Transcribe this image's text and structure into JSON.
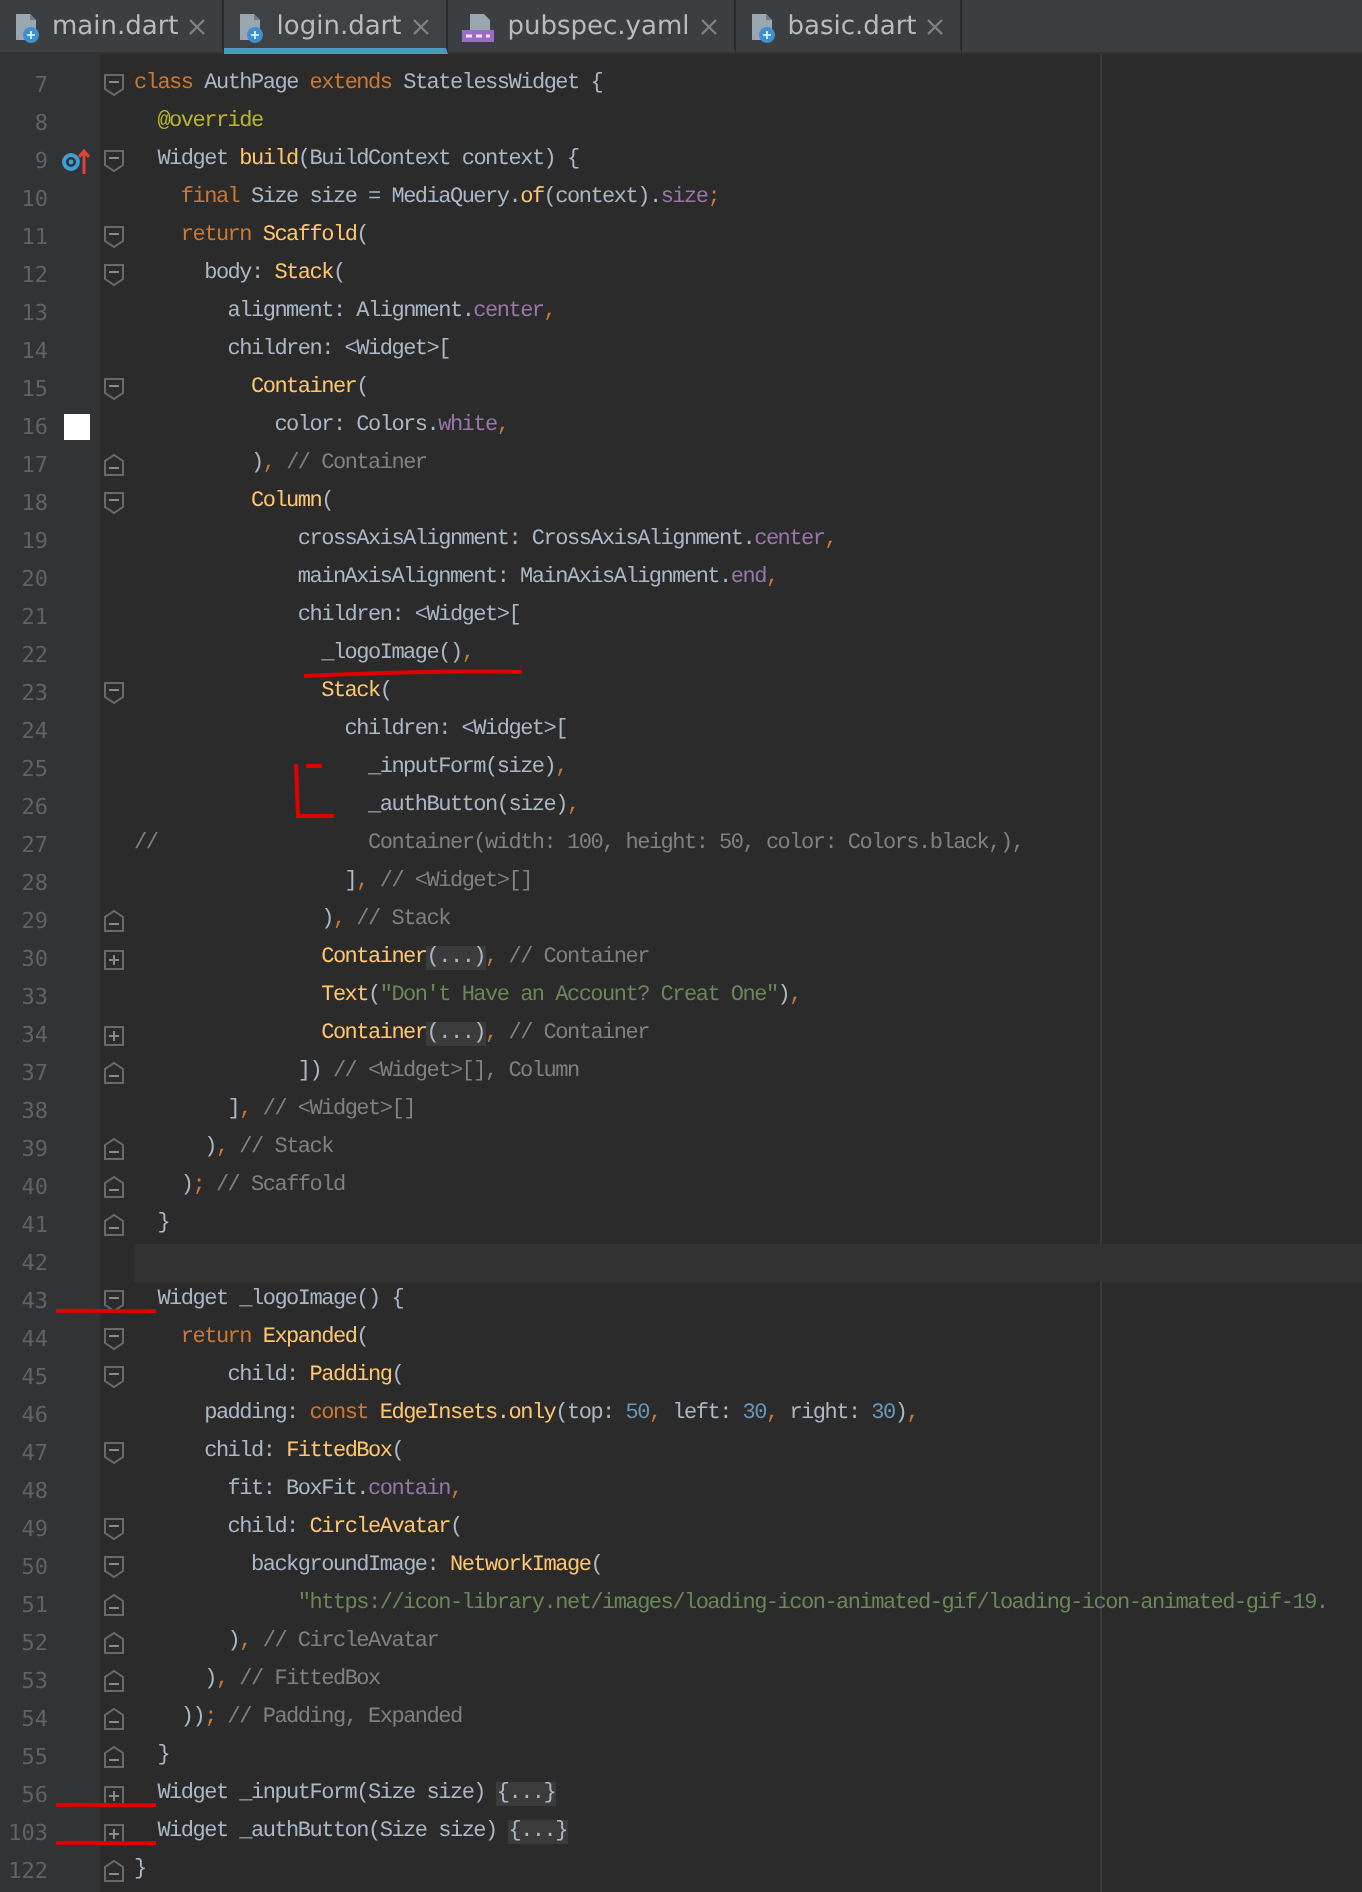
{
  "tabs": [
    {
      "label": "main.dart",
      "kind": "dart",
      "selected": false
    },
    {
      "label": "login.dart",
      "kind": "dart",
      "selected": true
    },
    {
      "label": "pubspec.yaml",
      "kind": "yaml",
      "selected": false
    },
    {
      "label": "basic.dart",
      "kind": "dart",
      "selected": false
    }
  ],
  "lines": [
    {
      "number": "7",
      "fold_marker": {
        "kind": "start"
      },
      "current": false,
      "tokens": [
        {
          "kind": "kw",
          "text": "class"
        },
        {
          "kind": "id",
          "text": " AuthPage "
        },
        {
          "kind": "kw",
          "text": "extends"
        },
        {
          "kind": "id",
          "text": " StatelessWidget {"
        }
      ]
    },
    {
      "number": "8",
      "current": false,
      "tokens": [
        {
          "kind": "ann",
          "text": "  @override"
        }
      ]
    },
    {
      "number": "9",
      "fold_marker": {
        "kind": "start"
      },
      "gutter_icon": {
        "kind": "override"
      },
      "current": false,
      "tokens": [
        {
          "kind": "id",
          "text": "  Widget "
        },
        {
          "kind": "fn",
          "text": "build"
        },
        {
          "kind": "id",
          "text": "(BuildContext context) {"
        }
      ]
    },
    {
      "number": "10",
      "current": false,
      "tokens": [
        {
          "kind": "kw",
          "text": "    final"
        },
        {
          "kind": "id",
          "text": " Size size = MediaQuery."
        },
        {
          "kind": "fn",
          "text": "of"
        },
        {
          "kind": "id",
          "text": "(context)."
        },
        {
          "kind": "prop",
          "text": "size"
        },
        {
          "kind": "kw",
          "text": ";"
        }
      ]
    },
    {
      "number": "11",
      "fold_marker": {
        "kind": "start"
      },
      "current": false,
      "tokens": [
        {
          "kind": "kw",
          "text": "    return "
        },
        {
          "kind": "fn",
          "text": "Scaffold"
        },
        {
          "kind": "id",
          "text": "("
        }
      ]
    },
    {
      "number": "12",
      "fold_marker": {
        "kind": "start"
      },
      "current": false,
      "tokens": [
        {
          "kind": "id",
          "text": "      body: "
        },
        {
          "kind": "fn",
          "text": "Stack"
        },
        {
          "kind": "id",
          "text": "("
        }
      ]
    },
    {
      "number": "13",
      "current": false,
      "tokens": [
        {
          "kind": "id",
          "text": "        alignment: Alignment."
        },
        {
          "kind": "prop",
          "text": "center"
        },
        {
          "kind": "kw",
          "text": ","
        }
      ]
    },
    {
      "number": "14",
      "current": false,
      "tokens": [
        {
          "kind": "id",
          "text": "        children: <Widget>["
        }
      ]
    },
    {
      "number": "15",
      "fold_marker": {
        "kind": "start"
      },
      "current": false,
      "tokens": [
        {
          "kind": "fn",
          "text": "          Container"
        },
        {
          "kind": "id",
          "text": "("
        }
      ]
    },
    {
      "number": "16",
      "gutter_icon": {
        "kind": "swatch"
      },
      "current": false,
      "tokens": [
        {
          "kind": "id",
          "text": "            color: Colors."
        },
        {
          "kind": "prop",
          "text": "white"
        },
        {
          "kind": "kw",
          "text": ","
        }
      ]
    },
    {
      "number": "17",
      "fold_marker": {
        "kind": "end"
      },
      "current": false,
      "tokens": [
        {
          "kind": "id",
          "text": "          )"
        },
        {
          "kind": "kw",
          "text": ","
        },
        {
          "kind": "cmt",
          "text": " // Container"
        }
      ]
    },
    {
      "number": "18",
      "fold_marker": {
        "kind": "start"
      },
      "current": false,
      "tokens": [
        {
          "kind": "fn",
          "text": "          Column"
        },
        {
          "kind": "id",
          "text": "("
        }
      ]
    },
    {
      "number": "19",
      "current": false,
      "tokens": [
        {
          "kind": "id",
          "text": "              crossAxisAlignment: CrossAxisAlignment."
        },
        {
          "kind": "prop",
          "text": "center"
        },
        {
          "kind": "kw",
          "text": ","
        }
      ]
    },
    {
      "number": "20",
      "current": false,
      "tokens": [
        {
          "kind": "id",
          "text": "              mainAxisAlignment: MainAxisAlignment."
        },
        {
          "kind": "prop",
          "text": "end"
        },
        {
          "kind": "kw",
          "text": ","
        }
      ]
    },
    {
      "number": "21",
      "current": false,
      "tokens": [
        {
          "kind": "id",
          "text": "              children: <Widget>["
        }
      ]
    },
    {
      "number": "22",
      "scribble": {
        "kind": "underline"
      },
      "current": false,
      "tokens": [
        {
          "kind": "id",
          "text": "                _logoImage()"
        },
        {
          "kind": "kw",
          "text": ","
        }
      ]
    },
    {
      "number": "23",
      "fold_marker": {
        "kind": "start"
      },
      "current": false,
      "tokens": [
        {
          "kind": "fn",
          "text": "                Stack"
        },
        {
          "kind": "id",
          "text": "("
        }
      ]
    },
    {
      "number": "24",
      "current": false,
      "tokens": [
        {
          "kind": "id",
          "text": "                  children: <Widget>["
        }
      ]
    },
    {
      "number": "25",
      "scribble": {
        "kind": "bracket"
      },
      "current": false,
      "tokens": [
        {
          "kind": "id",
          "text": "                    _inputForm(size)"
        },
        {
          "kind": "kw",
          "text": ","
        }
      ]
    },
    {
      "number": "26",
      "current": false,
      "tokens": [
        {
          "kind": "id",
          "text": "                    _authButton(size)"
        },
        {
          "kind": "kw",
          "text": ","
        }
      ]
    },
    {
      "number": "27",
      "current": false,
      "tokens": [
        {
          "kind": "cmt",
          "text": "//                  Container(width: 100, height: 50, color: Colors.black,),"
        }
      ]
    },
    {
      "number": "28",
      "current": false,
      "tokens": [
        {
          "kind": "id",
          "text": "                  ]"
        },
        {
          "kind": "kw",
          "text": ","
        },
        {
          "kind": "cmt",
          "text": " // <Widget>[]"
        }
      ]
    },
    {
      "number": "29",
      "fold_marker": {
        "kind": "end"
      },
      "current": false,
      "tokens": [
        {
          "kind": "id",
          "text": "                )"
        },
        {
          "kind": "kw",
          "text": ","
        },
        {
          "kind": "cmt",
          "text": " // Stack"
        }
      ]
    },
    {
      "number": "30",
      "fold_marker": {
        "kind": "collapsed"
      },
      "current": false,
      "tokens": [
        {
          "kind": "fn",
          "text": "                Container"
        },
        {
          "kind": "fold",
          "text": "(...)"
        },
        {
          "kind": "kw",
          "text": ","
        },
        {
          "kind": "cmt",
          "text": " // Container"
        }
      ]
    },
    {
      "number": "33",
      "current": false,
      "tokens": [
        {
          "kind": "fn",
          "text": "                Text"
        },
        {
          "kind": "id",
          "text": "("
        },
        {
          "kind": "str",
          "text": "\"Don't Have an Account? Creat One\""
        },
        {
          "kind": "id",
          "text": ")"
        },
        {
          "kind": "kw",
          "text": ","
        }
      ]
    },
    {
      "number": "34",
      "fold_marker": {
        "kind": "collapsed"
      },
      "current": false,
      "tokens": [
        {
          "kind": "fn",
          "text": "                Container"
        },
        {
          "kind": "fold",
          "text": "(...)"
        },
        {
          "kind": "kw",
          "text": ","
        },
        {
          "kind": "cmt",
          "text": " // Container"
        }
      ]
    },
    {
      "number": "37",
      "fold_marker": {
        "kind": "end"
      },
      "current": false,
      "tokens": [
        {
          "kind": "id",
          "text": "              ])"
        },
        {
          "kind": "cmt",
          "text": " // <Widget>[], Column"
        }
      ]
    },
    {
      "number": "38",
      "current": false,
      "tokens": [
        {
          "kind": "id",
          "text": "        ]"
        },
        {
          "kind": "kw",
          "text": ","
        },
        {
          "kind": "cmt",
          "text": " // <Widget>[]"
        }
      ]
    },
    {
      "number": "39",
      "fold_marker": {
        "kind": "end"
      },
      "current": false,
      "tokens": [
        {
          "kind": "id",
          "text": "      )"
        },
        {
          "kind": "kw",
          "text": ","
        },
        {
          "kind": "cmt",
          "text": " // Stack"
        }
      ]
    },
    {
      "number": "40",
      "fold_marker": {
        "kind": "end"
      },
      "current": false,
      "tokens": [
        {
          "kind": "id",
          "text": "    )"
        },
        {
          "kind": "kw",
          "text": ";"
        },
        {
          "kind": "cmt",
          "text": " // Scaffold"
        }
      ]
    },
    {
      "number": "41",
      "fold_marker": {
        "kind": "end"
      },
      "current": false,
      "tokens": [
        {
          "kind": "id",
          "text": "  }"
        }
      ]
    },
    {
      "number": "42",
      "current": true
    },
    {
      "number": "43",
      "fold_marker": {
        "kind": "start"
      },
      "scribble": {
        "kind": "dash"
      },
      "current": false,
      "tokens": [
        {
          "kind": "id",
          "text": "  Widget _logoImage() {"
        }
      ]
    },
    {
      "number": "44",
      "fold_marker": {
        "kind": "start"
      },
      "current": false,
      "tokens": [
        {
          "kind": "kw",
          "text": "    return "
        },
        {
          "kind": "fn",
          "text": "Expanded"
        },
        {
          "kind": "id",
          "text": "("
        }
      ]
    },
    {
      "number": "45",
      "fold_marker": {
        "kind": "start"
      },
      "current": false,
      "tokens": [
        {
          "kind": "id",
          "text": "        child: "
        },
        {
          "kind": "fn",
          "text": "Padding"
        },
        {
          "kind": "id",
          "text": "("
        }
      ]
    },
    {
      "number": "46",
      "current": false,
      "tokens": [
        {
          "kind": "id",
          "text": "      padding: "
        },
        {
          "kind": "kw",
          "text": "const "
        },
        {
          "kind": "fn",
          "text": "EdgeInsets.only"
        },
        {
          "kind": "id",
          "text": "(top: "
        },
        {
          "kind": "num",
          "text": "50"
        },
        {
          "kind": "kw",
          "text": ","
        },
        {
          "kind": "id",
          "text": " left: "
        },
        {
          "kind": "num",
          "text": "30"
        },
        {
          "kind": "kw",
          "text": ","
        },
        {
          "kind": "id",
          "text": " right: "
        },
        {
          "kind": "num",
          "text": "30"
        },
        {
          "kind": "id",
          "text": ")"
        },
        {
          "kind": "kw",
          "text": ","
        }
      ]
    },
    {
      "number": "47",
      "fold_marker": {
        "kind": "start"
      },
      "current": false,
      "tokens": [
        {
          "kind": "id",
          "text": "      child: "
        },
        {
          "kind": "fn",
          "text": "FittedBox"
        },
        {
          "kind": "id",
          "text": "("
        }
      ]
    },
    {
      "number": "48",
      "current": false,
      "tokens": [
        {
          "kind": "id",
          "text": "        fit: BoxFit."
        },
        {
          "kind": "prop",
          "text": "contain"
        },
        {
          "kind": "kw",
          "text": ","
        }
      ]
    },
    {
      "number": "49",
      "fold_marker": {
        "kind": "start"
      },
      "current": false,
      "tokens": [
        {
          "kind": "id",
          "text": "        child: "
        },
        {
          "kind": "fn",
          "text": "CircleAvatar"
        },
        {
          "kind": "id",
          "text": "("
        }
      ]
    },
    {
      "number": "50",
      "fold_marker": {
        "kind": "start"
      },
      "current": false,
      "tokens": [
        {
          "kind": "id",
          "text": "          backgroundImage: "
        },
        {
          "kind": "fn",
          "text": "NetworkImage"
        },
        {
          "kind": "id",
          "text": "("
        }
      ]
    },
    {
      "number": "51",
      "fold_marker": {
        "kind": "end"
      },
      "current": false,
      "tokens": [
        {
          "kind": "str",
          "text": "              \"https://icon-library.net/images/loading-icon-animated-gif/loading-icon-animated-gif-19."
        }
      ]
    },
    {
      "number": "52",
      "fold_marker": {
        "kind": "end"
      },
      "current": false,
      "tokens": [
        {
          "kind": "id",
          "text": "        )"
        },
        {
          "kind": "kw",
          "text": ","
        },
        {
          "kind": "cmt",
          "text": " // CircleAvatar"
        }
      ]
    },
    {
      "number": "53",
      "fold_marker": {
        "kind": "end"
      },
      "current": false,
      "tokens": [
        {
          "kind": "id",
          "text": "      )"
        },
        {
          "kind": "kw",
          "text": ","
        },
        {
          "kind": "cmt",
          "text": " // FittedBox"
        }
      ]
    },
    {
      "number": "54",
      "fold_marker": {
        "kind": "end"
      },
      "current": false,
      "tokens": [
        {
          "kind": "id",
          "text": "    ))"
        },
        {
          "kind": "kw",
          "text": ";"
        },
        {
          "kind": "cmt",
          "text": " // Padding, Expanded"
        }
      ]
    },
    {
      "number": "55",
      "fold_marker": {
        "kind": "end"
      },
      "current": false,
      "tokens": [
        {
          "kind": "id",
          "text": "  }"
        }
      ]
    },
    {
      "number": "56",
      "fold_marker": {
        "kind": "collapsed"
      },
      "scribble": {
        "kind": "dash"
      },
      "current": false,
      "tokens": [
        {
          "kind": "id",
          "text": "  Widget _inputForm(Size size) "
        },
        {
          "kind": "fold",
          "text": "{...}"
        }
      ]
    },
    {
      "number": "103",
      "fold_marker": {
        "kind": "collapsed"
      },
      "scribble": {
        "kind": "dash"
      },
      "current": false,
      "tokens": [
        {
          "kind": "id",
          "text": "  Widget _authButton(Size size) "
        },
        {
          "kind": "fold",
          "text": "{...}"
        }
      ]
    },
    {
      "number": "122",
      "fold_marker": {
        "kind": "end"
      },
      "current": false,
      "tokens": [
        {
          "kind": "id",
          "text": "}"
        }
      ]
    }
  ]
}
